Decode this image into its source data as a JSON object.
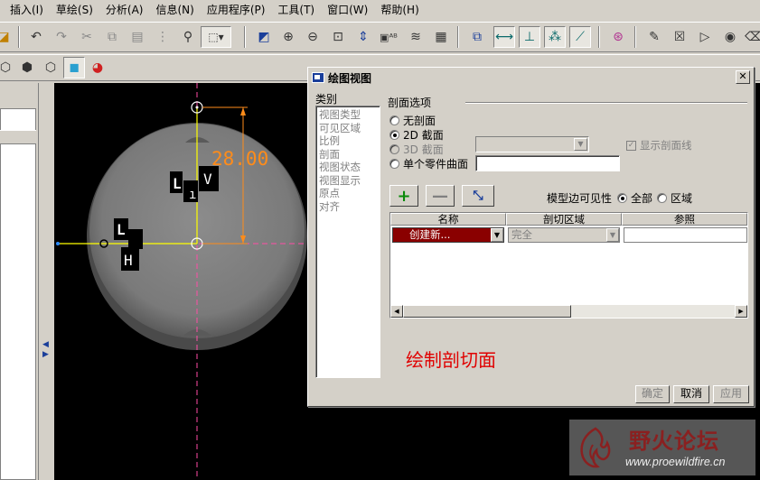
{
  "menu": [
    "插入(I)",
    "草绘(S)",
    "分析(A)",
    "信息(N)",
    "应用程序(P)",
    "工具(T)",
    "窗口(W)",
    "帮助(H)"
  ],
  "drawing": {
    "dimension_value": "28.00",
    "labels": [
      "L",
      "V",
      "L",
      "H"
    ]
  },
  "dialog": {
    "title": "绘图视图",
    "close_glyph": "✕",
    "category_label": "类别",
    "categories": [
      "视图类型",
      "可见区域",
      "比例",
      "剖面",
      "视图状态",
      "视图显示",
      "原点",
      "对齐"
    ],
    "section_options_label": "剖面选项",
    "options": {
      "none": "无剖面",
      "2d": "2D 截面",
      "3d": "3D 截面",
      "single_part": "单个零件曲面"
    },
    "show_xsec_label": "显示剖面线",
    "model_edge_visibility_label": "模型边可见性",
    "visibility_all": "全部",
    "visibility_region": "区域",
    "table": {
      "headers": [
        "名称",
        "剖切区域",
        "参照"
      ],
      "row": {
        "name": "创建新...",
        "cut_region": "完全",
        "reference": ""
      }
    },
    "buttons": {
      "add": "+",
      "remove": "—",
      "flip": "⤡",
      "ok": "确定",
      "cancel": "取消",
      "apply": "应用"
    }
  },
  "annotation": "绘制剖切面",
  "watermark": {
    "title": "野火论坛",
    "url": "www.proewildfire.cn"
  },
  "colors": {
    "annotation": "#e00000",
    "selected_row": "#8a0000",
    "dimension": "#ff8c1a"
  }
}
